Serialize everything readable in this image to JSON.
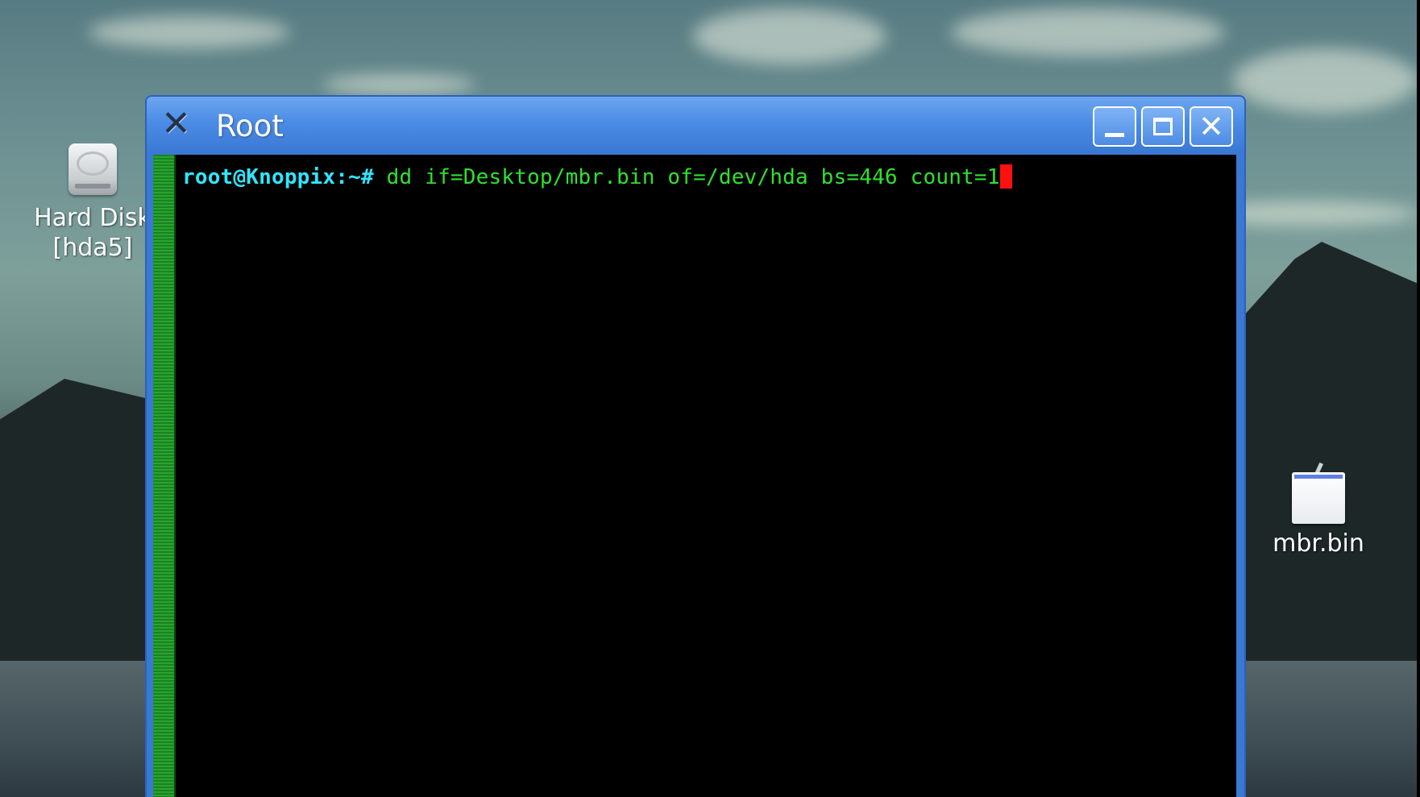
{
  "desktop": {
    "icons": [
      {
        "label_line1": "Hard Disk",
        "label_line2": "[hda5]",
        "icon": "hard-disk-icon"
      },
      {
        "label": "mbr.bin",
        "icon": "file-icon"
      }
    ]
  },
  "window": {
    "title": "Root",
    "app_icon": "x-icon",
    "controls": {
      "minimize": "minimize-icon",
      "maximize": "maximize-icon",
      "close": "close-icon"
    }
  },
  "terminal": {
    "prompt": "root@Knoppix:~# ",
    "command": "dd if=Desktop/mbr.bin of=/dev/hda bs=446 count=1"
  },
  "colors": {
    "titlebar": "#3a78d4",
    "prompt": "#2fe6ff",
    "command": "#2ee12e",
    "cursor": "#ff1010",
    "scrollbar": "#1e8c24",
    "terminal_bg": "#000000"
  }
}
